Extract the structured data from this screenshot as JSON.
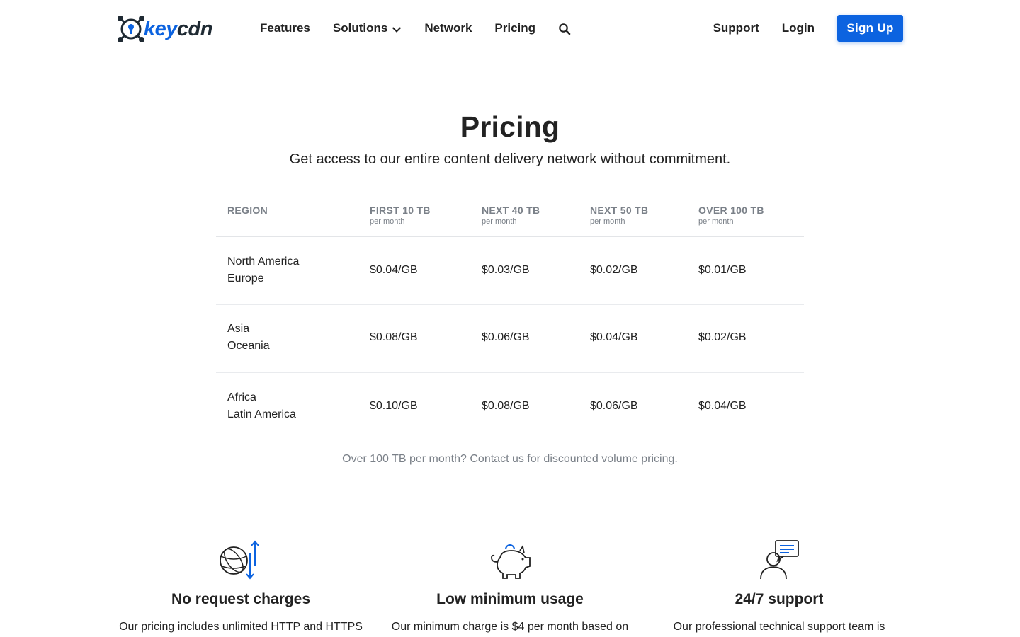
{
  "brand": {
    "key": "key",
    "cdn": "cdn",
    "colors": {
      "accent": "#0c63e0",
      "dark": "#1f2a33"
    }
  },
  "nav": {
    "features": "Features",
    "solutions": "Solutions",
    "network": "Network",
    "pricing": "Pricing",
    "support": "Support",
    "login": "Login",
    "signup": "Sign Up"
  },
  "hero": {
    "title": "Pricing",
    "subtitle": "Get access to our entire content delivery network without commitment."
  },
  "table": {
    "headers": [
      {
        "label": "REGION",
        "sub": ""
      },
      {
        "label": "FIRST 10 TB",
        "sub": "per month"
      },
      {
        "label": "NEXT 40 TB",
        "sub": "per month"
      },
      {
        "label": "NEXT 50 TB",
        "sub": "per month"
      },
      {
        "label": "OVER 100 TB",
        "sub": "per month"
      }
    ],
    "rows": [
      {
        "regions": [
          "North America",
          "Europe"
        ],
        "prices": [
          "$0.04/GB",
          "$0.03/GB",
          "$0.02/GB",
          "$0.01/GB"
        ]
      },
      {
        "regions": [
          "Asia",
          "Oceania"
        ],
        "prices": [
          "$0.08/GB",
          "$0.06/GB",
          "$0.04/GB",
          "$0.02/GB"
        ]
      },
      {
        "regions": [
          "Africa",
          "Latin America"
        ],
        "prices": [
          "$0.10/GB",
          "$0.08/GB",
          "$0.06/GB",
          "$0.04/GB"
        ]
      }
    ]
  },
  "note": "Over 100 TB per month? Contact us for discounted volume pricing.",
  "features": [
    {
      "icon": "globe-transfer-icon",
      "title": "No request charges",
      "desc": "Our pricing includes unlimited HTTP and HTTPS"
    },
    {
      "icon": "piggy-bank-icon",
      "title": "Low minimum usage",
      "desc": "Our minimum charge is $4 per month based on"
    },
    {
      "icon": "support-chat-icon",
      "title": "24/7 support",
      "desc": "Our professional technical support team is"
    }
  ]
}
